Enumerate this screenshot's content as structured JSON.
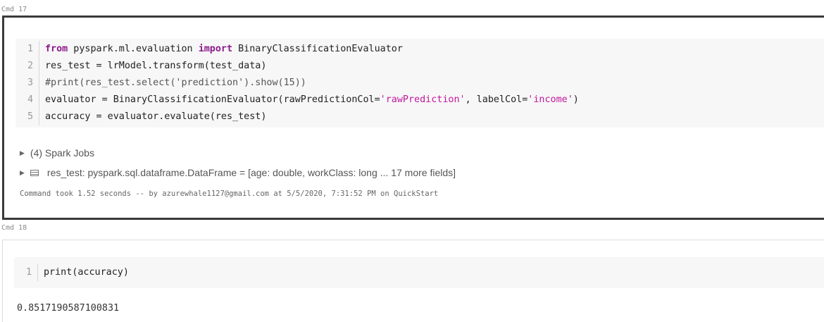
{
  "cells": [
    {
      "label": "Cmd 17",
      "lines": [
        {
          "num": "1",
          "tokens": [
            {
              "t": "from",
              "c": "kw"
            },
            {
              "t": " pyspark.ml.evaluation ",
              "c": ""
            },
            {
              "t": "import",
              "c": "kw"
            },
            {
              "t": " BinaryClassificationEvaluator",
              "c": ""
            }
          ]
        },
        {
          "num": "2",
          "tokens": [
            {
              "t": "res_test = lrModel.transform(test_data)",
              "c": ""
            }
          ]
        },
        {
          "num": "3",
          "tokens": [
            {
              "t": "#print(res_test.select('prediction').show(15))",
              "c": "cmt"
            }
          ]
        },
        {
          "num": "4",
          "tokens": [
            {
              "t": "evaluator = BinaryClassificationEvaluator(rawPredictionCol=",
              "c": ""
            },
            {
              "t": "'rawPrediction'",
              "c": "str"
            },
            {
              "t": ", labelCol=",
              "c": ""
            },
            {
              "t": "'income'",
              "c": "str"
            },
            {
              "t": ")",
              "c": ""
            }
          ]
        },
        {
          "num": "5",
          "tokens": [
            {
              "t": "accuracy = evaluator.evaluate(res_test)",
              "c": ""
            }
          ]
        }
      ],
      "spark_jobs": "(4) Spark Jobs",
      "dataframe_info": "res_test:  pyspark.sql.dataframe.DataFrame = [age: double, workClass: long ... 17 more fields]",
      "command_took": "Command took 1.52 seconds -- by azurewhale1127@gmail.com at 5/5/2020, 7:31:52 PM on QuickStart"
    },
    {
      "label": "Cmd 18",
      "lines": [
        {
          "num": "1",
          "tokens": [
            {
              "t": "print(accuracy)",
              "c": ""
            }
          ]
        }
      ],
      "output": "0.8517190587100831"
    }
  ]
}
